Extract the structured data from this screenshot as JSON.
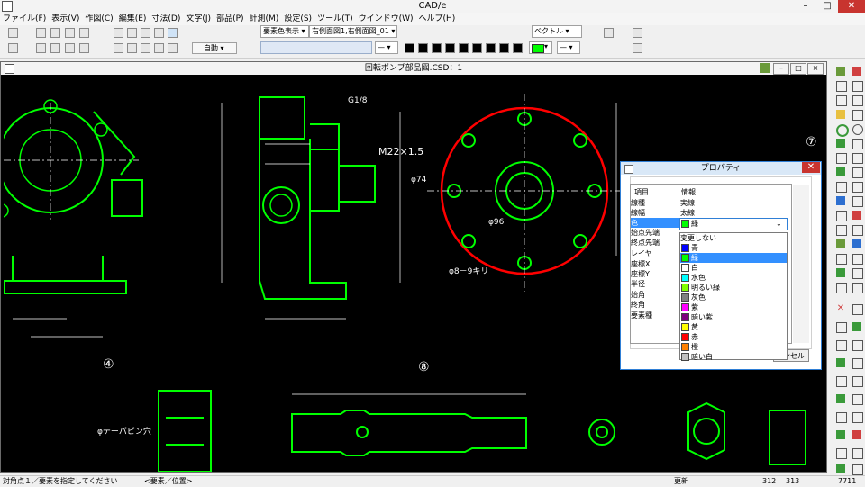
{
  "window": {
    "title": "CAD/e"
  },
  "menu": [
    "ファイル(F)",
    "表示(V)",
    "作図(C)",
    "編集(E)",
    "寸法(D)",
    "文字(J)",
    "部品(P)",
    "計測(M)",
    "設定(S)",
    "ツール(T)",
    "ウインドウ(W)",
    "ヘルプ(H)"
  ],
  "toolbar": {
    "mode_label": "自動",
    "display_select": "要素色表示",
    "view_select": "右側面図1,右側面図_01",
    "vector_select": "ベクトル"
  },
  "drawing_window": {
    "title": "回転ポンプ部品図.CSD：1"
  },
  "drawing": {
    "labels": {
      "detail4": "④",
      "detail8": "⑧",
      "detail7": "⑦",
      "m22": "M22×1.5",
      "g18": "G1/8",
      "holes": "φ8－9キリ",
      "taper": "φテーパピン穴",
      "d96": "φ96",
      "d74": "φ74"
    }
  },
  "property_dialog": {
    "title": "プロパティ",
    "col_item": "項目",
    "col_info": "情報",
    "rows": [
      {
        "item": "線種",
        "info": "実線"
      },
      {
        "item": "線幅",
        "info": "太線"
      },
      {
        "item": "色",
        "info": "緑"
      },
      {
        "item": "始点先端",
        "info": ""
      },
      {
        "item": "終点先端",
        "info": ""
      },
      {
        "item": "レイヤ",
        "info": ""
      },
      {
        "item": "座標X",
        "info": ""
      },
      {
        "item": "座標Y",
        "info": ""
      },
      {
        "item": "半径",
        "info": ""
      },
      {
        "item": "始角",
        "info": ""
      },
      {
        "item": "終角",
        "info": ""
      },
      {
        "item": "要素種",
        "info": ""
      }
    ],
    "cancel_partial": "ンセル",
    "color_options": [
      {
        "label": "変更しない",
        "color": ""
      },
      {
        "label": "青",
        "color": "#0000ff"
      },
      {
        "label": "緑",
        "color": "#00ff00"
      },
      {
        "label": "白",
        "color": "#ffffff"
      },
      {
        "label": "水色",
        "color": "#00ffff"
      },
      {
        "label": "明るい緑",
        "color": "#80ff00"
      },
      {
        "label": "灰色",
        "color": "#808080"
      },
      {
        "label": "紫",
        "color": "#ff00ff"
      },
      {
        "label": "暗い紫",
        "color": "#800080"
      },
      {
        "label": "黄",
        "color": "#ffff00"
      },
      {
        "label": "赤",
        "color": "#ff0000"
      },
      {
        "label": "橙",
        "color": "#ff8000"
      },
      {
        "label": "暗い白",
        "color": "#c0c0c0"
      }
    ],
    "selected_color": "緑"
  },
  "statusbar": {
    "prompt": "対角点１／要素を指定してください",
    "mode": "<要素／位置>",
    "update": "更新",
    "x": "312",
    "y": "313",
    "count": "7711"
  },
  "colors": {
    "line": "#00ff00",
    "red": "#ff0000",
    "dim": "#ffffff",
    "bg": "#000000"
  }
}
